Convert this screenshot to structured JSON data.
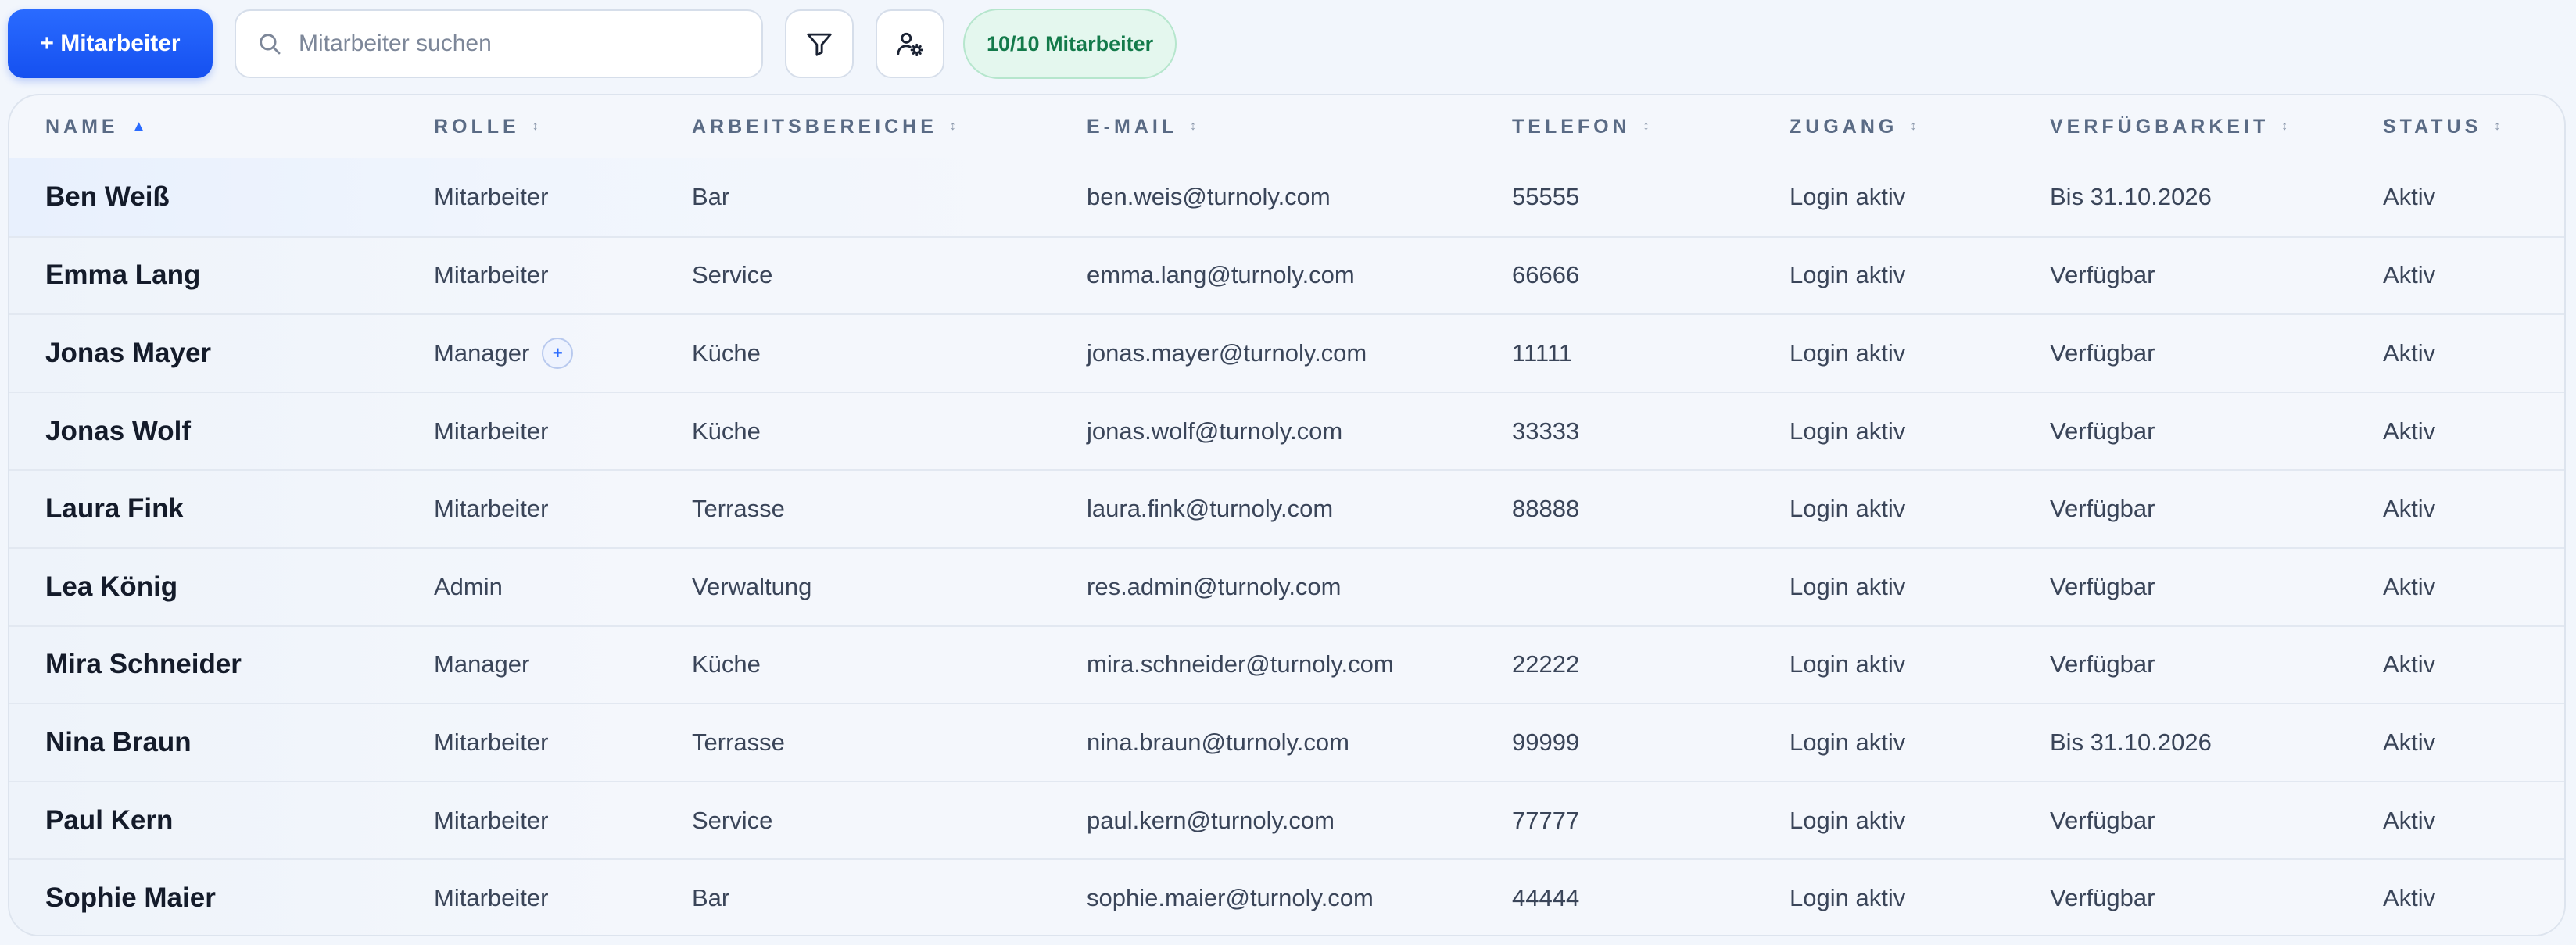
{
  "toolbar": {
    "add_label": "+ Mitarbeiter",
    "search_placeholder": "Mitarbeiter suchen",
    "search_value": "",
    "filter_icon": "filter-icon",
    "user_settings_icon": "user-settings-icon",
    "count_label": "10/10 Mitarbeiter"
  },
  "table": {
    "columns": {
      "name": "NAME",
      "role": "ROLLE",
      "areas": "ARBEITSBEREICHE",
      "email": "E-MAIL",
      "phone": "TELEFON",
      "access": "ZUGANG",
      "availability": "VERFÜGBARKEIT",
      "status": "STATUS"
    },
    "sort": {
      "column": "name",
      "direction": "asc",
      "active_glyph": "▲",
      "inactive_glyph": "↕"
    },
    "rows": [
      {
        "name": "Ben Weiß",
        "role": "Mitarbeiter",
        "areas": "Bar",
        "email": "ben.weis@turnoly.com",
        "phone": "55555",
        "access": "Login aktiv",
        "availability": "Bis 31.10.2026",
        "status": "Aktiv"
      },
      {
        "name": "Emma Lang",
        "role": "Mitarbeiter",
        "areas": "Service",
        "email": "emma.lang@turnoly.com",
        "phone": "66666",
        "access": "Login aktiv",
        "availability": "Verfügbar",
        "status": "Aktiv"
      },
      {
        "name": "Jonas Mayer",
        "role": "Manager",
        "role_extra": "+",
        "areas": "Küche",
        "email": "jonas.mayer@turnoly.com",
        "phone": "11111",
        "access": "Login aktiv",
        "availability": "Verfügbar",
        "status": "Aktiv"
      },
      {
        "name": "Jonas Wolf",
        "role": "Mitarbeiter",
        "areas": "Küche",
        "email": "jonas.wolf@turnoly.com",
        "phone": "33333",
        "access": "Login aktiv",
        "availability": "Verfügbar",
        "status": "Aktiv"
      },
      {
        "name": "Laura Fink",
        "role": "Mitarbeiter",
        "areas": "Terrasse",
        "email": "laura.fink@turnoly.com",
        "phone": "88888",
        "access": "Login aktiv",
        "availability": "Verfügbar",
        "status": "Aktiv"
      },
      {
        "name": "Lea König",
        "role": "Admin",
        "areas": "Verwaltung",
        "email": "res.admin@turnoly.com",
        "phone": "",
        "access": "Login aktiv",
        "availability": "Verfügbar",
        "status": "Aktiv"
      },
      {
        "name": "Mira Schneider",
        "role": "Manager",
        "areas": "Küche",
        "email": "mira.schneider@turnoly.com",
        "phone": "22222",
        "access": "Login aktiv",
        "availability": "Verfügbar",
        "status": "Aktiv"
      },
      {
        "name": "Nina Braun",
        "role": "Mitarbeiter",
        "areas": "Terrasse",
        "email": "nina.braun@turnoly.com",
        "phone": "99999",
        "access": "Login aktiv",
        "availability": "Bis 31.10.2026",
        "status": "Aktiv"
      },
      {
        "name": "Paul Kern",
        "role": "Mitarbeiter",
        "areas": "Service",
        "email": "paul.kern@turnoly.com",
        "phone": "77777",
        "access": "Login aktiv",
        "availability": "Verfügbar",
        "status": "Aktiv"
      },
      {
        "name": "Sophie Maier",
        "role": "Mitarbeiter",
        "areas": "Bar",
        "email": "sophie.maier@turnoly.com",
        "phone": "44444",
        "access": "Login aktiv",
        "availability": "Verfügbar",
        "status": "Aktiv"
      }
    ]
  },
  "colors": {
    "accent": "#1550f0",
    "badge_bg": "#e4f7ee",
    "badge_text": "#137a4a",
    "page_bg": "#f2f6fc"
  }
}
